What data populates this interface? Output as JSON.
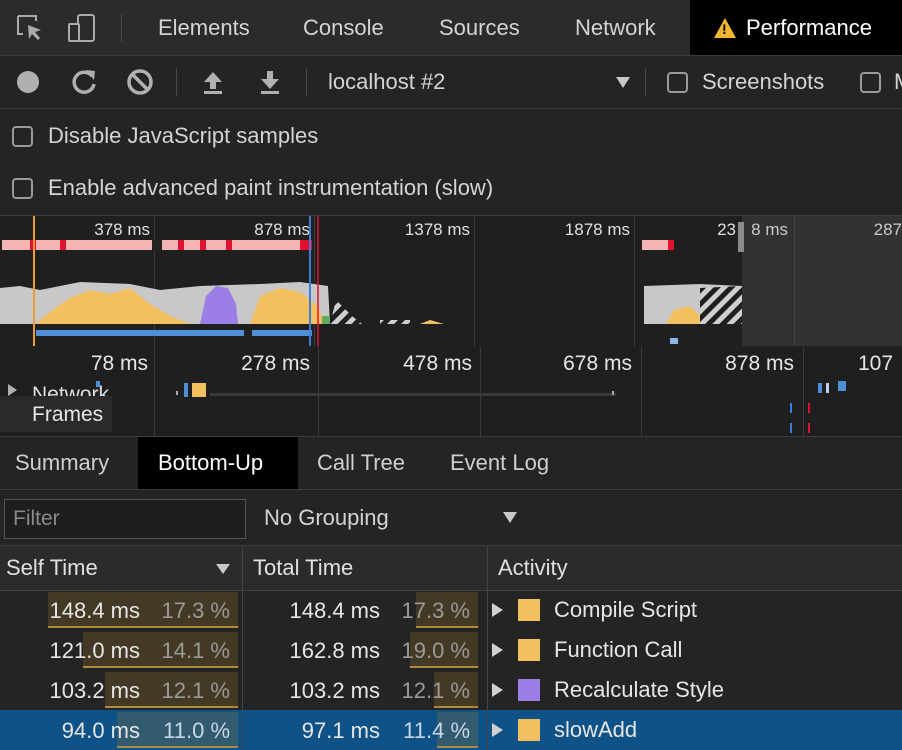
{
  "tabbar": {
    "inspect_icon": "inspect-icon",
    "device_icon": "device-toggle-icon",
    "tabs": [
      {
        "label": "Elements"
      },
      {
        "label": "Console"
      },
      {
        "label": "Sources"
      },
      {
        "label": "Network"
      },
      {
        "label": "Performance",
        "warning": true
      }
    ]
  },
  "toolbar": {
    "record_icon": "record-icon",
    "reload_icon": "reload-icon",
    "clear_icon": "clear-icon",
    "upload_icon": "upload-icon",
    "download_icon": "download-icon",
    "target": "localhost #2",
    "screenshots_label": "Screenshots",
    "screenshots_checked": false,
    "memory_label": "M"
  },
  "settings": {
    "disable_js_samples": "Disable JavaScript samples",
    "enable_paint": "Enable advanced paint instrumentation (slow)"
  },
  "overview": {
    "ticks": [
      "378 ms",
      "878 ms",
      "1378 ms",
      "1878 ms",
      "23",
      "8 ms",
      "287"
    ],
    "colors": {
      "scripting": "#f2c05f",
      "rendering": "#9b7fe6",
      "idle": "#c8c8c8",
      "fps": "#f4b4b4",
      "long": "#e0102f",
      "network": "#4f8fd6"
    }
  },
  "ruler": {
    "ticks": [
      "78 ms",
      "278 ms",
      "478 ms",
      "678 ms",
      "878 ms",
      "107"
    ],
    "network_label": "Network",
    "frames_label": "Frames"
  },
  "details_tabs": [
    {
      "label": "Summary"
    },
    {
      "label": "Bottom-Up",
      "active": true
    },
    {
      "label": "Call Tree"
    },
    {
      "label": "Event Log"
    }
  ],
  "filter": {
    "placeholder": "Filter",
    "value": ""
  },
  "grouping": {
    "selected": "No Grouping"
  },
  "table": {
    "columns": {
      "self": "Self Time",
      "total": "Total Time",
      "activity": "Activity"
    },
    "rows": [
      {
        "self_ms": "148.4 ms",
        "self_pct": "17.3 %",
        "self_frac": 0.173,
        "total_ms": "148.4 ms",
        "total_pct": "17.3 %",
        "total_frac": 0.173,
        "activity": "Compile Script",
        "color": "#f2c05f",
        "selected": false
      },
      {
        "self_ms": "121.0 ms",
        "self_pct": "14.1 %",
        "self_frac": 0.141,
        "total_ms": "162.8 ms",
        "total_pct": "19.0 %",
        "total_frac": 0.19,
        "activity": "Function Call",
        "color": "#f2c05f",
        "selected": false
      },
      {
        "self_ms": "103.2 ms",
        "self_pct": "12.1 %",
        "self_frac": 0.121,
        "total_ms": "103.2 ms",
        "total_pct": "12.1 %",
        "total_frac": 0.121,
        "activity": "Recalculate Style",
        "color": "#9b7fe6",
        "selected": false
      },
      {
        "self_ms": "94.0 ms",
        "self_pct": "11.0 %",
        "self_frac": 0.11,
        "total_ms": "97.1 ms",
        "total_pct": "11.4 %",
        "total_frac": 0.114,
        "activity": "slowAdd",
        "color": "#f2c05f",
        "selected": true
      }
    ]
  }
}
